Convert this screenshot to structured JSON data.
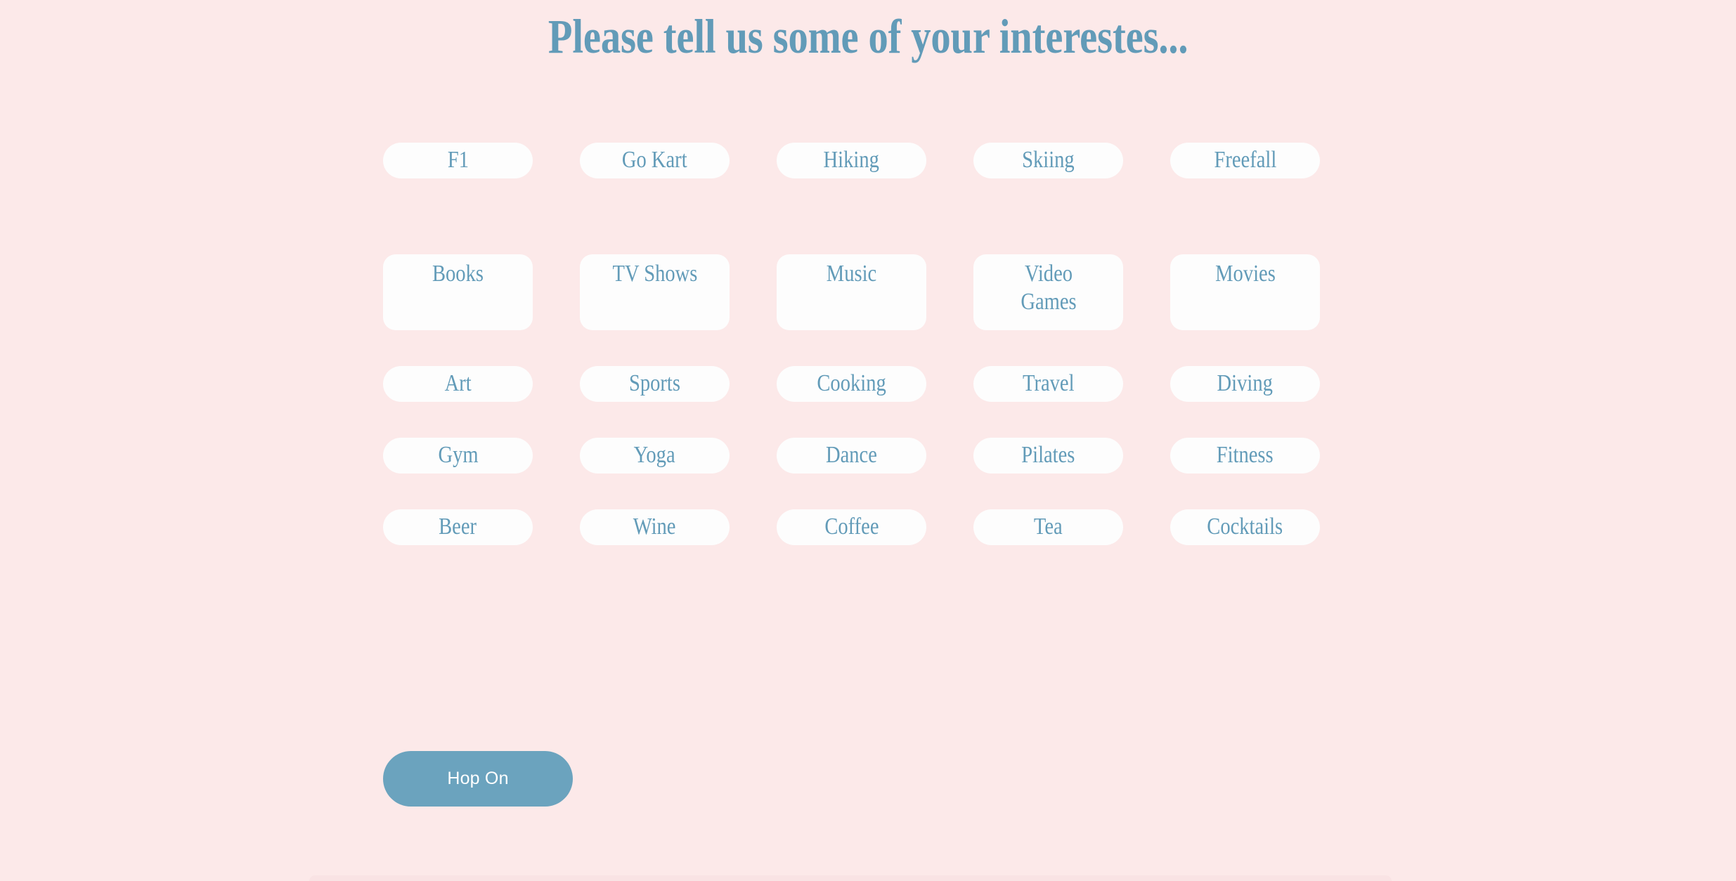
{
  "page": {
    "background_color": "#fce9e9",
    "accent_color": "#629bb8",
    "chip_background_color": "#fdfdfd",
    "button_color": "#6ba3be"
  },
  "header": {
    "title": "Please tell us some of your interestes..."
  },
  "interests": {
    "rows": [
      {
        "style": "pill",
        "chips": [
          {
            "label": "F1"
          },
          {
            "label": "Go Kart"
          },
          {
            "label": "Hiking"
          },
          {
            "label": "Skiing"
          },
          {
            "label": "Freefall"
          }
        ]
      },
      {
        "style": "tall",
        "chips": [
          {
            "label": "Books"
          },
          {
            "label": "TV Shows"
          },
          {
            "label": "Music"
          },
          {
            "label": "Video Games"
          },
          {
            "label": "Movies"
          }
        ]
      },
      {
        "style": "pill",
        "chips": [
          {
            "label": "Art"
          },
          {
            "label": "Sports"
          },
          {
            "label": "Cooking"
          },
          {
            "label": "Travel"
          },
          {
            "label": "Diving"
          }
        ]
      },
      {
        "style": "pill",
        "chips": [
          {
            "label": "Gym"
          },
          {
            "label": "Yoga"
          },
          {
            "label": "Dance"
          },
          {
            "label": "Pilates"
          },
          {
            "label": "Fitness"
          }
        ]
      },
      {
        "style": "pill",
        "chips": [
          {
            "label": "Beer"
          },
          {
            "label": "Wine"
          },
          {
            "label": "Coffee"
          },
          {
            "label": "Tea"
          },
          {
            "label": "Cocktails"
          }
        ]
      }
    ]
  },
  "footer": {
    "submit_label": "Hop On"
  }
}
